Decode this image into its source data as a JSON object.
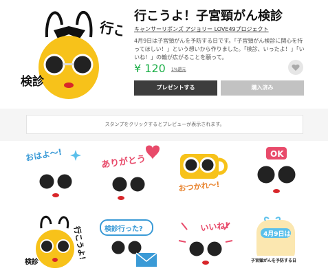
{
  "product": {
    "title": "行こうよ！子宮頸がん検診",
    "author": "キャンサーリボンズ アジョリー LOVE49プロジェクト",
    "description": "4月9日は子宮頸がんを予防する日です。「子宮頸がん検診に関心を持ってほしい！」という想いから作りました。「検診、いったよ！」「いいね！」の輪が広がることを願って。",
    "price": "¥ 120",
    "price_note": "1%還元",
    "main_image_text_top": "行こうよ！",
    "main_image_text_bottom": "検診"
  },
  "buttons": {
    "present": "プレゼントする",
    "purchased": "購入済み"
  },
  "preview_hint": "スタンプをクリックするとプレビューが表示されます。",
  "stickers": [
    {
      "name": "ohayo",
      "text": "おはよ〜!"
    },
    {
      "name": "arigato",
      "text": "ありがとう"
    },
    {
      "name": "otsukare",
      "text": "おつかれ〜!"
    },
    {
      "name": "ok",
      "text": "OK"
    },
    {
      "name": "ikouyo",
      "text": "行こうよ！",
      "text2": "検診"
    },
    {
      "name": "kenshin-itta",
      "text": "検診行った?"
    },
    {
      "name": "iine",
      "text": "いいね!"
    },
    {
      "name": "april9",
      "text": "4月9日は",
      "text2": "子宮頸がんを予防する日"
    }
  ],
  "colors": {
    "price_green": "#1fb04a",
    "present_button": "#3d3d3d",
    "purchased_button": "#c2c2c2",
    "face_yellow": "#f7c21a",
    "heart_pink": "#e84a6a"
  }
}
